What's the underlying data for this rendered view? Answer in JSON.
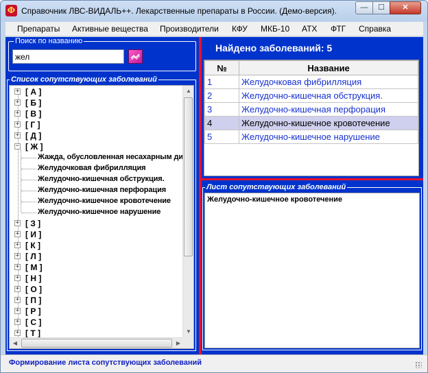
{
  "window": {
    "title": "Справочник ЛВС-ВИДАЛЬ++. Лекарственные препараты в России. (Демо-версия).",
    "icon": "pharmacy-logo-icon",
    "min_glyph": "—",
    "max_glyph": "☐",
    "close_glyph": "✕"
  },
  "menu": [
    "Препараты",
    "Активные вещества",
    "Производители",
    "КФУ",
    "МКБ-10",
    "АТХ",
    "ФТГ",
    "Справка"
  ],
  "search": {
    "legend": "Поиск по названию",
    "value": "жел",
    "button_icon": "search-go-icon"
  },
  "tree": {
    "legend": "Список сопутствующих заболеваний",
    "groups_before": [
      "[ А ]",
      "[ Б ]",
      "[ В ]",
      "[ Г ]",
      "[ Д ]"
    ],
    "expanded_group": "[ Ж ]",
    "expanded_children": [
      "Жажда, обусловленная несахарным диабетом",
      "Желудочковая фибрилляция",
      "Желудочно-кишечная обструкция.",
      "Желудочно-кишечная перфорация",
      "Желудочно-кишечное кровотечение",
      "Желудочно-кишечное нарушение"
    ],
    "groups_after": [
      "[ З ]",
      "[ И ]",
      "[ К ]",
      "[ Л ]",
      "[ М ]",
      "[ Н ]",
      "[ О ]",
      "[ П ]",
      "[ Р ]",
      "[ С ]",
      "[ Т ]"
    ],
    "plus_glyph": "+",
    "minus_glyph": "−"
  },
  "results": {
    "found_label": "Найдено заболеваний: 5",
    "columns": [
      "№",
      "Название"
    ],
    "rows": [
      {
        "num": "1",
        "name": "Желудочковая фибрилляция"
      },
      {
        "num": "2",
        "name": "Желудочно-кишечная обструкция."
      },
      {
        "num": "3",
        "name": "Желудочно-кишечная перфорация"
      },
      {
        "num": "4",
        "name": "Желудочно-кишечное кровотечение"
      },
      {
        "num": "5",
        "name": "Желудочно-кишечное нарушение"
      }
    ],
    "selected_num": "4"
  },
  "sheet": {
    "legend": "Лист сопутствующих заболеваний",
    "content": "Желудочно-кишечное кровотечение"
  },
  "status": {
    "text": "Формирование листа сопутствующих заболеваний"
  },
  "colors": {
    "panel_bg": "#0033cc",
    "splitter": "#e8102a",
    "link_text": "#1630d0",
    "selected_row": "#cfcfee"
  }
}
